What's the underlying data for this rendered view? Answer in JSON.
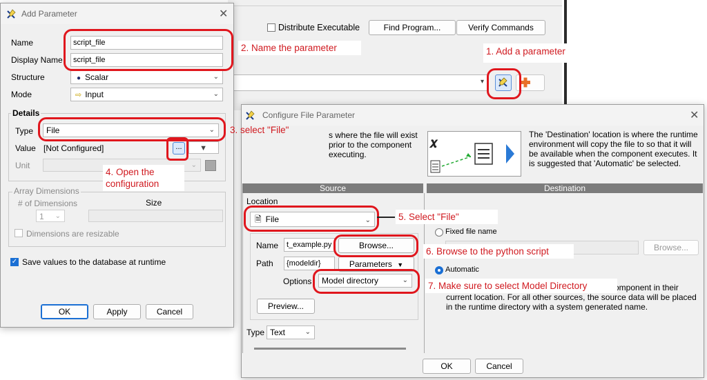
{
  "background_window": {
    "distribute_label": "Distribute Executable",
    "find_program_label": "Find Program...",
    "verify_commands_label": "Verify Commands"
  },
  "add_parameter": {
    "title": "Add Parameter",
    "name_label": "Name",
    "name_value": "script_file",
    "display_name_label": "Display Name",
    "display_name_value": "script_file",
    "structure_label": "Structure",
    "structure_value": "Scalar",
    "mode_label": "Mode",
    "mode_value": "Input",
    "details_label": "Details",
    "type_label": "Type",
    "type_value": "File",
    "value_label": "Value",
    "value_text": "[Not Configured]",
    "value_button_label": "...",
    "unit_label": "Unit",
    "array_dimensions_label": "Array Dimensions",
    "num_dimensions_label": "# of Dimensions",
    "num_dimensions_value": "1",
    "size_label": "Size",
    "resizable_label": "Dimensions are resizable",
    "save_values_label": "Save values to the database at runtime",
    "ok_label": "OK",
    "apply_label": "Apply",
    "cancel_label": "Cancel"
  },
  "configure_file": {
    "title": "Configure File Parameter",
    "intro_text": "s where the file will exist prior to the component executing.",
    "destination_text": "The 'Destination' location is where the runtime environment will copy the file to so that it will be available when the component executes. It is suggested that 'Automatic' be selected.",
    "source_header": "Source",
    "destination_header": "Destination",
    "location_label": "Location",
    "location_value": "File",
    "name_label": "Name",
    "name_value": "t_example.py",
    "browse_label": "Browse...",
    "path_label": "Path",
    "path_value": "{modeldir}",
    "parameters_label": "Parameters",
    "options_label": "Options",
    "options_value": "Model directory",
    "preview_label": "Preview...",
    "type_label": "Type",
    "type_value": "Text",
    "fixed_file_name_label": "Fixed file name",
    "dest_browse_label": "Browse...",
    "automatic_label": "Automatic",
    "automatic_text": "e component in their current location.  For all other sources, the source data will be placed in the runtime directory with a system generated name.",
    "ok_label": "OK",
    "cancel_label": "Cancel"
  },
  "annotations": {
    "step1": "1. Add a parameter",
    "step2": "2. Name the parameter",
    "step3": "3. select \"File\"",
    "step4": "4. Open the configuration",
    "step5": "5. Select \"File\"",
    "step6": "6. Browse to the python script",
    "step7": "7. Make sure to select Model Directory"
  },
  "colors": {
    "annotation_red": "#e0161d",
    "header_gray": "#7c7c7c",
    "accent_blue": "#1a6fd4"
  },
  "icons": [
    "add-parameter-icon",
    "add-plus-icon",
    "close-icon",
    "file-icon",
    "input-mode-icon",
    "scalar-bullet-icon",
    "chevron-down-icon",
    "unit-picker-icon",
    "phx-logo-icon",
    "arrow-right-icon"
  ]
}
